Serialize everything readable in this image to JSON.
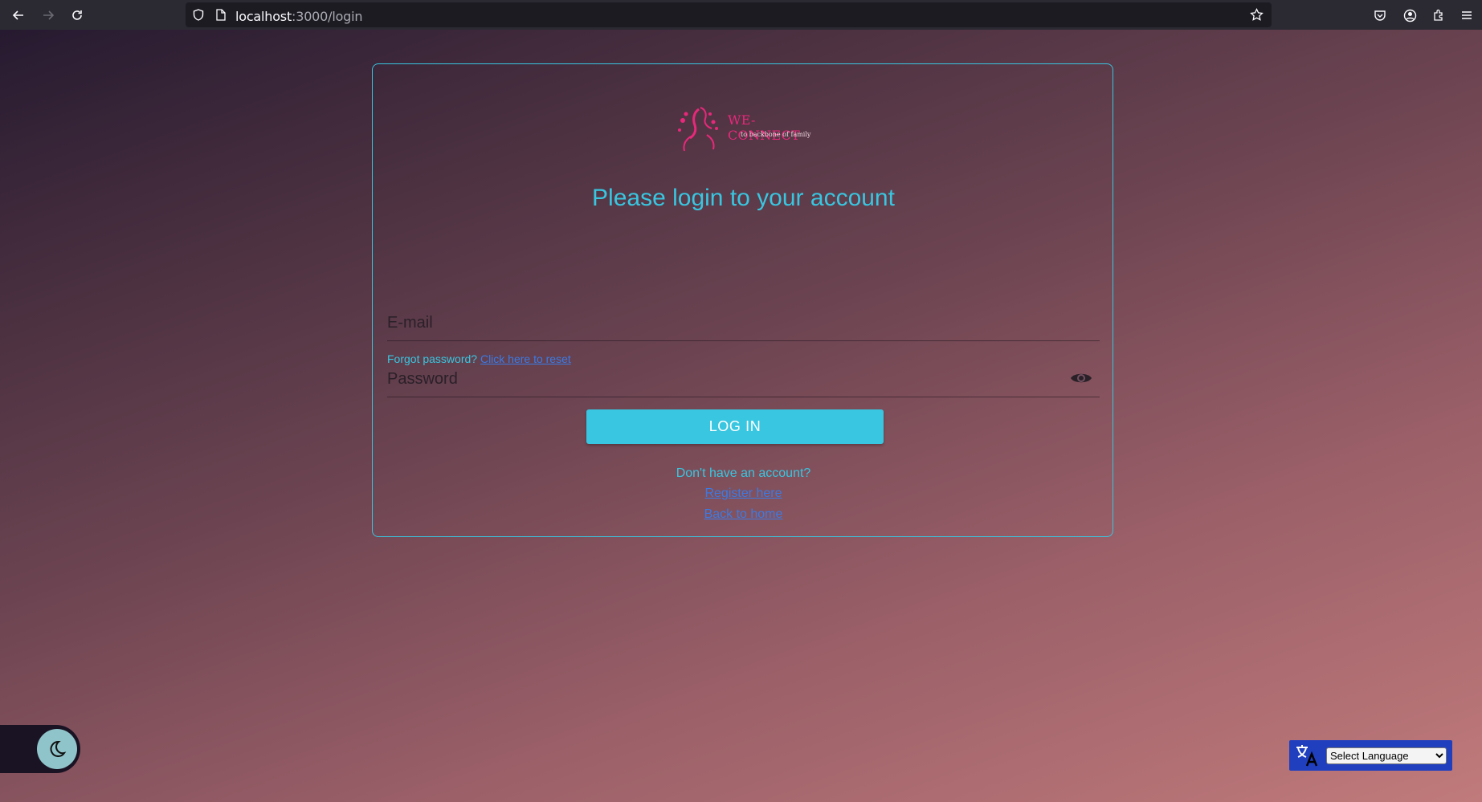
{
  "browser": {
    "url_host": "localhost",
    "url_path": ":3000/login"
  },
  "logo": {
    "brand": "WE-CONNECT",
    "tagline": "to backbone of family"
  },
  "login": {
    "title": "Please login to your account",
    "email_placeholder": "E-mail",
    "password_placeholder": "Password",
    "forgot_text": "Forgot password?",
    "forgot_link": "Click here to reset",
    "login_button": "LOG IN",
    "no_account_text": "Don't have an account?",
    "register_link": "Register here",
    "home_link": "Back to home"
  },
  "translate": {
    "selected": "Select Language"
  },
  "colors": {
    "accent": "#38c6e0",
    "link": "#3a7be6",
    "brand": "#e8287a"
  }
}
